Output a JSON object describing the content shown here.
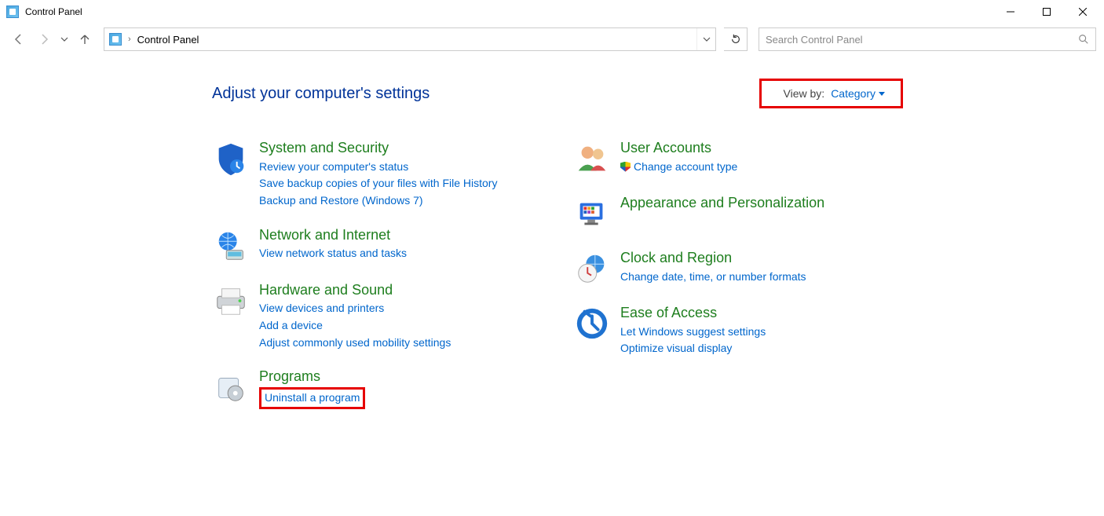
{
  "window": {
    "title": "Control Panel"
  },
  "breadcrumb": {
    "root": "Control Panel"
  },
  "search": {
    "placeholder": "Search Control Panel"
  },
  "page": {
    "heading": "Adjust your computer's settings",
    "viewby_label": "View by:",
    "viewby_value": "Category"
  },
  "categories": {
    "system_security": {
      "title": "System and Security",
      "links": [
        "Review your computer's status",
        "Save backup copies of your files with File History",
        "Backup and Restore (Windows 7)"
      ]
    },
    "network_internet": {
      "title": "Network and Internet",
      "links": [
        "View network status and tasks"
      ]
    },
    "hardware_sound": {
      "title": "Hardware and Sound",
      "links": [
        "View devices and printers",
        "Add a device",
        "Adjust commonly used mobility settings"
      ]
    },
    "programs": {
      "title": "Programs",
      "links": [
        "Uninstall a program"
      ]
    },
    "user_accounts": {
      "title": "User Accounts",
      "links": [
        "Change account type"
      ]
    },
    "appearance": {
      "title": "Appearance and Personalization"
    },
    "clock_region": {
      "title": "Clock and Region",
      "links": [
        "Change date, time, or number formats"
      ]
    },
    "ease_access": {
      "title": "Ease of Access",
      "links": [
        "Let Windows suggest settings",
        "Optimize visual display"
      ]
    }
  }
}
